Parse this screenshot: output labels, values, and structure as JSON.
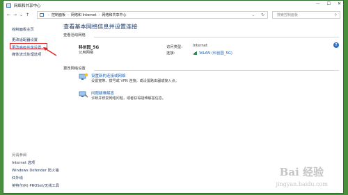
{
  "window": {
    "title": "网络和共享中心",
    "controls": [
      "—",
      "☐",
      "✕"
    ]
  },
  "addressbar": {
    "back": "←",
    "forward": "→",
    "history": "⌄",
    "up": "↑",
    "breadcrumb": [
      "控制面板",
      "网络和 Internet",
      "网络和共享中心"
    ],
    "separator": "›",
    "dropdown": "⌄",
    "refresh": "↻",
    "search_placeholder": "搜索控制面板",
    "search_icon": "⚲"
  },
  "sidebar": {
    "links": [
      "控制面板主页",
      "更改适配器设置",
      "更改高级共享设置",
      "媒体流式处理选项"
    ],
    "see_also_heading": "另请参阅",
    "see_also": [
      "Internet 选项",
      "Windows Defender 防火墙",
      "红外线",
      "英特尔(R) PROSet/无线工具"
    ]
  },
  "main": {
    "title": "查看基本网络信息并设置连接",
    "active_networks_heading": "查看活动网络",
    "network": {
      "name": "科创园_5G",
      "type": "公用网络",
      "access_type_label": "访问类型:",
      "access_type_value": "Internet",
      "connections_label": "连接:",
      "connections_value": "WLAN (科创园_5G)"
    },
    "change_settings_heading": "更改网络设置",
    "tasks": [
      {
        "link": "设置新的连接或网络",
        "desc": "设置宽带、拨号或 VPN 连接；或设置路由器或接入点。"
      },
      {
        "link": "问题疑难解答",
        "desc": "诊断并修复网络问题，或者获得疑难解答信息。"
      }
    ],
    "help": "?"
  },
  "watermark": {
    "main": "Bai 经验",
    "url": "jingyan.baidu.com"
  },
  "colors": {
    "link": "#1a5fb4",
    "title": "#1e3a6e",
    "highlight": "#e02020",
    "background": "#4a8f3c"
  }
}
